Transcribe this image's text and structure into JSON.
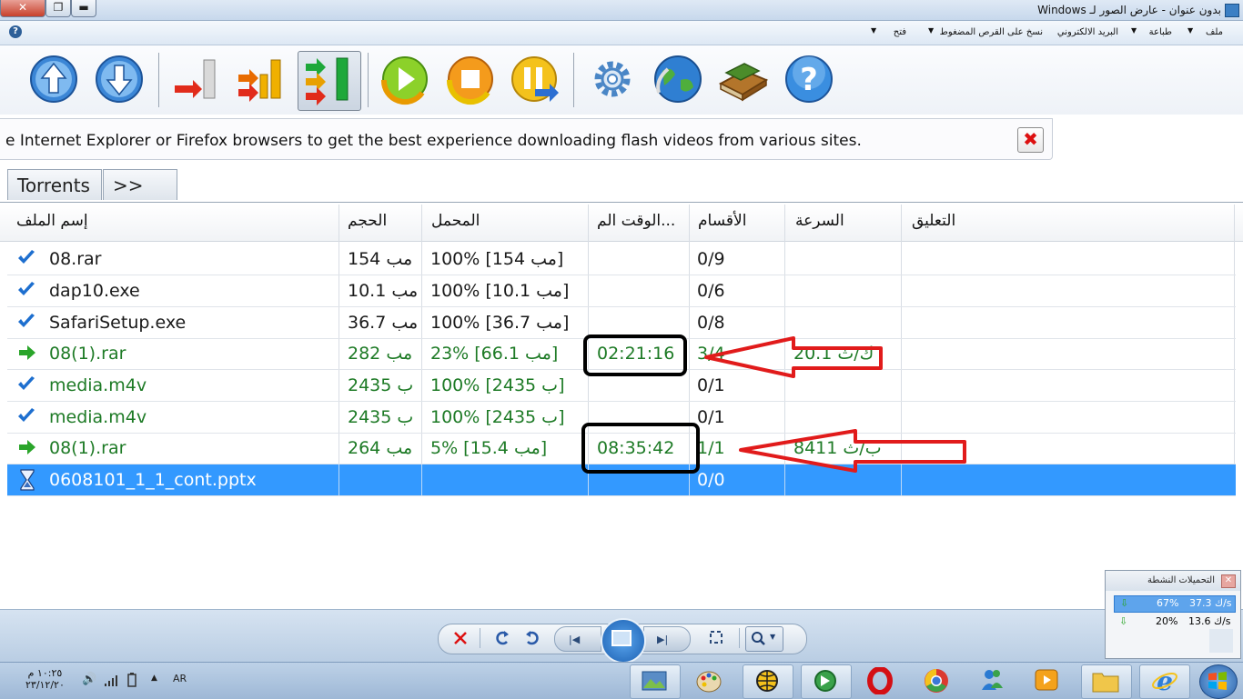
{
  "window": {
    "title": "بدون عنوان - عارض الصور لـ Windows",
    "close_glyph": "✕",
    "restore_glyph": "❐",
    "minimize_glyph": "▬"
  },
  "menu": {
    "items": [
      "ملف",
      "طباعة",
      "البريد الالكتروني",
      "نسخ على القرص المضغوط",
      "فتح"
    ],
    "help_glyph": "?"
  },
  "info_bar": {
    "text": "e Internet Explorer or Firefox browsers to get the best experience downloading flash videos from various sites.",
    "close_glyph": "✖"
  },
  "tabs": [
    "Torrents",
    ">>"
  ],
  "table": {
    "columns": [
      "إسم الملف",
      "الحجم",
      "المحمل",
      "...الوقت الم",
      "الأقسام",
      "السرعة",
      "التعليق"
    ],
    "rows": [
      {
        "name": "08.rar",
        "size": "154 مب",
        "loaded": "100% [154 مب]",
        "time": "",
        "sections": "0/9",
        "speed": "",
        "status": "done"
      },
      {
        "name": "dap10.exe",
        "size": "10.1 مب",
        "loaded": "100% [10.1 مب]",
        "time": "",
        "sections": "0/6",
        "speed": "",
        "status": "done"
      },
      {
        "name": "SafariSetup.exe",
        "size": "36.7 مب",
        "loaded": "100% [36.7 مب]",
        "time": "",
        "sections": "0/8",
        "speed": "",
        "status": "done"
      },
      {
        "name": "08(1).rar",
        "size": "282 مب",
        "loaded": "23% [66.1 مب]",
        "time": "02:21:16",
        "sections": "3/4",
        "speed": "20.1 ك/ث",
        "status": "active"
      },
      {
        "name": "media.m4v",
        "size": "2435 ب",
        "loaded": "100% [2435 ب]",
        "time": "",
        "sections": "0/1",
        "speed": "",
        "status": "done-green"
      },
      {
        "name": "media.m4v",
        "size": "2435 ب",
        "loaded": "100% [2435 ب]",
        "time": "",
        "sections": "0/1",
        "speed": "",
        "status": "done-green"
      },
      {
        "name": "08(1).rar",
        "size": "264 مب",
        "loaded": "5% [15.4 مب]",
        "time": "08:35:42",
        "sections": "1/1",
        "speed": "8411 ب/ث",
        "status": "active"
      },
      {
        "name": "0608101_1_1_cont.pptx",
        "size": "",
        "loaded": "",
        "time": "",
        "sections": "0/0",
        "speed": "",
        "status": "queued"
      }
    ]
  },
  "active_popup": {
    "title": "التحميلات النشطة",
    "close_glyph": "✕",
    "rows": [
      {
        "percent": "67%",
        "speed": "37.3 ك/s"
      },
      {
        "percent": "20%",
        "speed": "13.6 ك/s"
      }
    ]
  },
  "tray": {
    "time": "١٠:٢٥ م",
    "date": "٢٣/١٢/٢٠",
    "language": "AR"
  },
  "colors": {
    "annotation_arrow": "#e11b1b",
    "selection": "#3399ff",
    "active_text": "#1d7a25"
  }
}
